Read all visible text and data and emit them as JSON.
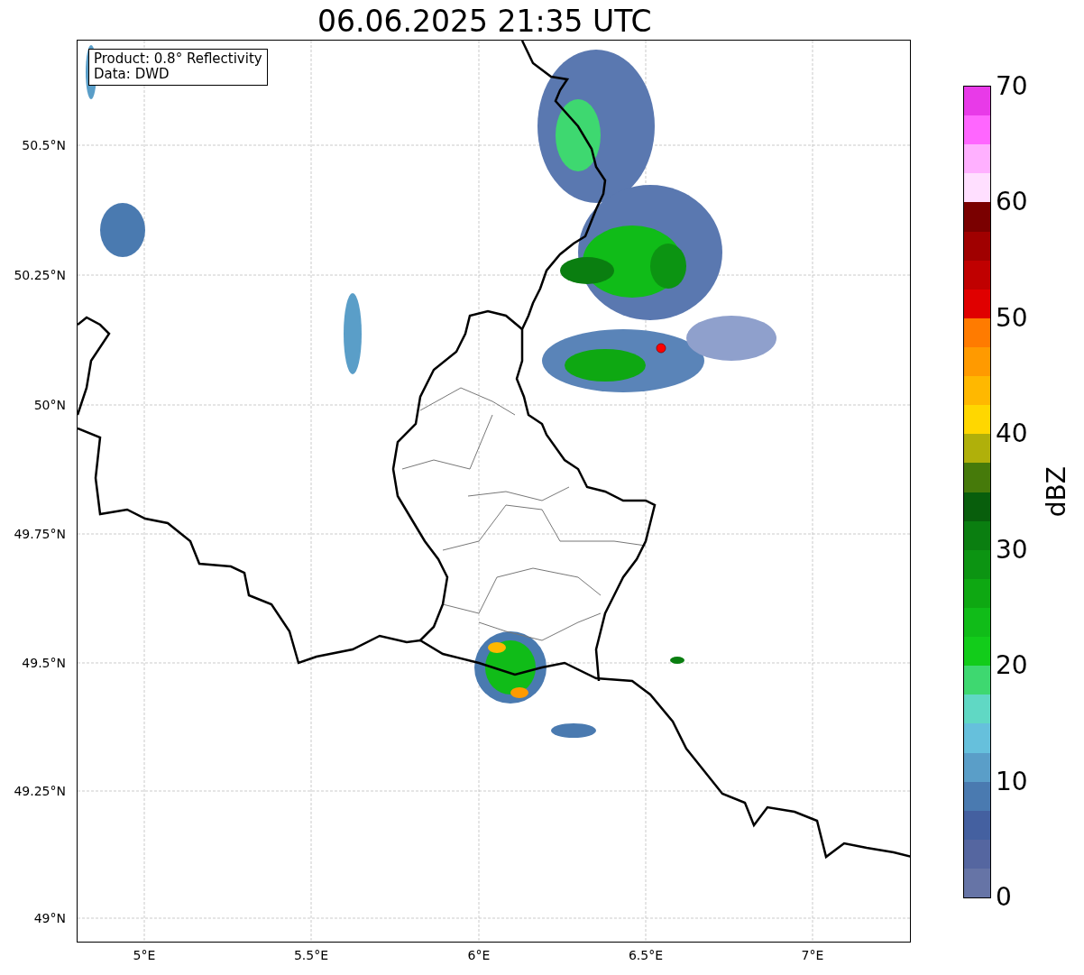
{
  "title": "06.06.2025 21:35 UTC",
  "info_box": {
    "lines": [
      "Product: 0.8° Reflectivity",
      "Data: DWD"
    ]
  },
  "y_ticks": [
    "50.5°N",
    "50.25°N",
    "50°N",
    "49.75°N",
    "49.5°N",
    "49.25°N",
    "49°N"
  ],
  "x_ticks": [
    "5°E",
    "5.5°E",
    "6°E",
    "6.5°E",
    "7°E"
  ],
  "colorbar": {
    "label": "dBZ",
    "ticks": [
      "70",
      "60",
      "50",
      "40",
      "30",
      "20",
      "10",
      "0"
    ],
    "steps": [
      {
        "color": "#e83ae8"
      },
      {
        "color": "#ff66ff"
      },
      {
        "color": "#ffb0ff"
      },
      {
        "color": "#ffdfff"
      },
      {
        "color": "#7a0000"
      },
      {
        "color": "#a00000"
      },
      {
        "color": "#c00000"
      },
      {
        "color": "#e00000"
      },
      {
        "color": "#ff7b00"
      },
      {
        "color": "#ff9a00"
      },
      {
        "color": "#ffb800"
      },
      {
        "color": "#ffd700"
      },
      {
        "color": "#b0b00a"
      },
      {
        "color": "#467a0a"
      },
      {
        "color": "#085e0c"
      },
      {
        "color": "#0a7e10"
      },
      {
        "color": "#0c9412"
      },
      {
        "color": "#0ea812"
      },
      {
        "color": "#10bc18"
      },
      {
        "color": "#12cc1a"
      },
      {
        "color": "#3ed870"
      },
      {
        "color": "#60d8c4"
      },
      {
        "color": "#66c0dc"
      },
      {
        "color": "#5a9ec8"
      },
      {
        "color": "#4a7ab0"
      },
      {
        "color": "#4460a0"
      },
      {
        "color": "#5566a0"
      },
      {
        "color": "#6674a6"
      }
    ]
  }
}
